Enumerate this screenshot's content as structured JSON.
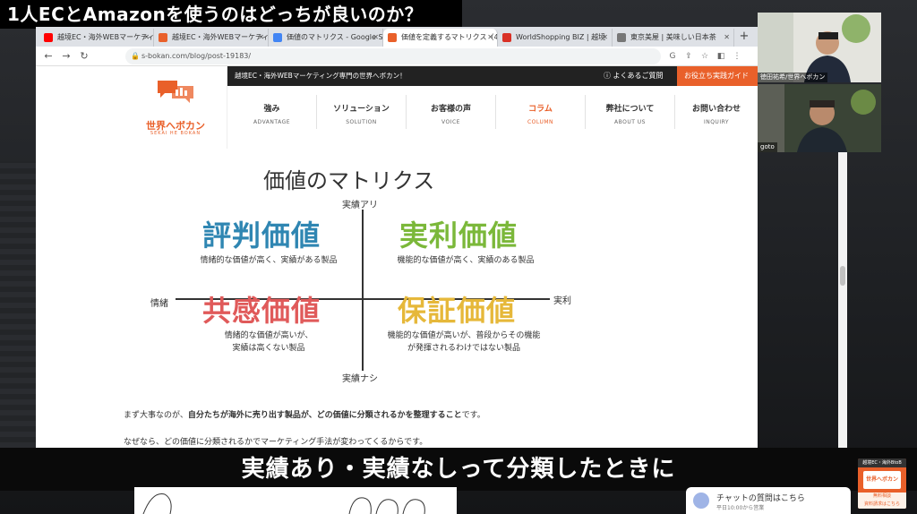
{
  "video": {
    "title_banner": "1人ECとAmazonを使うのはどっちが良いのか？",
    "subtitle": "実績あり・実績なしって分類したときに",
    "participants": [
      {
        "name": "徳田祐希/世界へボカン"
      },
      {
        "name": "goto"
      }
    ]
  },
  "browser": {
    "tabs": [
      {
        "label": "越境EC・海外WEBマーケティ",
        "favicon_color": "#ff0000"
      },
      {
        "label": "越境EC・海外WEBマーケティ",
        "favicon_color": "#e9602a"
      },
      {
        "label": "価値のマトリクス - Google Se",
        "favicon_color": "#4285f4"
      },
      {
        "label": "価値を定義するマトリクス（4)",
        "favicon_color": "#e9602a",
        "active": true
      },
      {
        "label": "WorldShopping BIZ | 越境",
        "favicon_color": "#d93025"
      },
      {
        "label": "東京美屋 | 美味しい日本茶",
        "favicon_color": "#777777"
      }
    ],
    "url": "s-bokan.com/blog/post-19183/",
    "new_tab_icon": "plus-icon"
  },
  "site": {
    "logo_text": "世界へボカン",
    "logo_sub": "SEKAI HE BOKAN",
    "tagline": "越境EC・海外WEBマーケティング専門の世界へボカン！",
    "faq_label": "よくあるご質問",
    "cta_label": "お役立ち実践ガイド",
    "nav": [
      {
        "ja": "強み",
        "en": "ADVANTAGE"
      },
      {
        "ja": "ソリューション",
        "en": "SOLUTION"
      },
      {
        "ja": "お客様の声",
        "en": "VOICE"
      },
      {
        "ja": "コラム",
        "en": "COLUMN",
        "current": true
      },
      {
        "ja": "弊社について",
        "en": "ABOUT US"
      },
      {
        "ja": "お問い合わせ",
        "en": "INQUIRY"
      }
    ],
    "accent_color": "#e9602a"
  },
  "matrix": {
    "title": "価値のマトリクス",
    "axis_top": "実績アリ",
    "axis_bottom": "実績ナシ",
    "axis_left": "情緒",
    "axis_right": "実利",
    "q1": {
      "head": "評判価値",
      "desc": "情緒的な価値が高く、実績がある製品",
      "color": "#2f86b2"
    },
    "q2": {
      "head": "実利価値",
      "desc": "機能的な価値が高く、実績のある製品",
      "color": "#7bb83a"
    },
    "q3": {
      "head": "共感価値",
      "desc1": "情緒的な価値が高いが、",
      "desc2": "実績は高くない製品",
      "color": "#e05a5a"
    },
    "q4": {
      "head": "保証価値",
      "desc1": "機能的な価値が高いが、普段からその機能",
      "desc2": "が発揮されるわけではない製品",
      "color": "#e6b83a"
    }
  },
  "article": {
    "p1_before": "まず大事なのが、",
    "p1_bold": "自分たちが海外に売り出す製品が、どの価値に分類されるかを整理すること",
    "p1_after": "です。",
    "p2": "なぜなら、どの価値に分類されるかでマーケティング手法が変わってくるからです。"
  },
  "chat": {
    "label": "チャットの質問はこちら",
    "hours": "平日10:00から営業"
  },
  "mini_logo": {
    "top": "越境EC・海外BtoB",
    "name": "世界へボカン",
    "foot1": "無料相談",
    "foot2": "資料請求はこちら"
  }
}
